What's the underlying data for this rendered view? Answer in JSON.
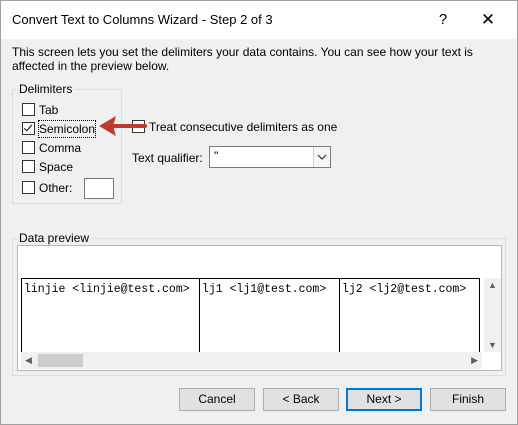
{
  "window": {
    "title": "Convert Text to Columns Wizard - Step 2 of 3",
    "help_label": "?",
    "close_label": "✕"
  },
  "description": "This screen lets you set the delimiters your data contains.  You can see how your text is affected in the preview below.",
  "delimiters": {
    "legend": "Delimiters",
    "items": [
      {
        "label": "Tab",
        "checked": false
      },
      {
        "label": "Semicolon",
        "checked": true
      },
      {
        "label": "Comma",
        "checked": false
      },
      {
        "label": "Space",
        "checked": false
      },
      {
        "label": "Other:",
        "checked": false
      }
    ],
    "other_value": ""
  },
  "options": {
    "treat_consecutive_label": "Treat consecutive delimiters as one",
    "treat_consecutive_checked": false,
    "text_qualifier_label": "Text qualifier:",
    "text_qualifier_value": "\""
  },
  "preview": {
    "legend": "Data preview",
    "cells": [
      "linjie <linjie@test.com>",
      "lj1 <lj1@test.com>",
      "lj2 <lj2@test.com>"
    ]
  },
  "buttons": {
    "cancel": "Cancel",
    "back": "< Back",
    "next": "Next >",
    "finish": "Finish"
  },
  "colors": {
    "annotation_arrow": "#c0392b",
    "default_button_border": "#0078d7"
  },
  "icons": {
    "dropdown": "chevron-down-icon",
    "annotation": "arrow-left-icon"
  }
}
